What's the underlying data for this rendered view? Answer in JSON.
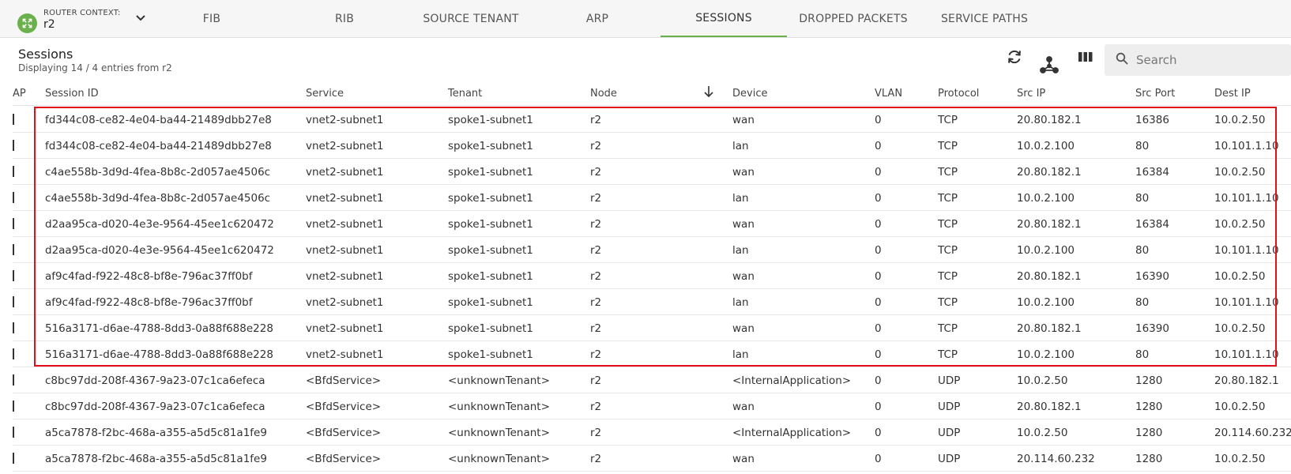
{
  "router": {
    "label": "ROUTER CONTEXT:",
    "value": "r2"
  },
  "tabs": [
    {
      "label": "FIB",
      "active": false
    },
    {
      "label": "RIB",
      "active": false
    },
    {
      "label": "SOURCE TENANT",
      "active": false
    },
    {
      "label": "ARP",
      "active": false
    },
    {
      "label": "SESSIONS",
      "active": true
    },
    {
      "label": "DROPPED PACKETS",
      "active": false
    },
    {
      "label": "SERVICE PATHS",
      "active": false
    }
  ],
  "page": {
    "title": "Sessions",
    "subtitle": "Displaying 14 / 4 entries from r2"
  },
  "search": {
    "placeholder": "Search",
    "value": ""
  },
  "colors": {
    "accent": "#6ab04c",
    "highlight": "#e3101c"
  },
  "icons": [
    "refresh-icon",
    "topology-icon",
    "columns-icon",
    "search-icon",
    "chevron-down-icon",
    "sort-down-icon"
  ],
  "table": {
    "partial_left_header": "AP",
    "columns": [
      "Session ID",
      "Service",
      "Tenant",
      "Node",
      "Device",
      "VLAN",
      "Protocol",
      "Src IP",
      "Src Port",
      "Dest IP"
    ],
    "sorted_column": "Node",
    "rows": [
      [
        "fd344c08-ce82-4e04-ba44-21489dbb27e8",
        "vnet2-subnet1",
        "spoke1-subnet1",
        "r2",
        "wan",
        "0",
        "TCP",
        "20.80.182.1",
        "16386",
        "10.0.2.50"
      ],
      [
        "fd344c08-ce82-4e04-ba44-21489dbb27e8",
        "vnet2-subnet1",
        "spoke1-subnet1",
        "r2",
        "lan",
        "0",
        "TCP",
        "10.0.2.100",
        "80",
        "10.101.1.10"
      ],
      [
        "c4ae558b-3d9d-4fea-8b8c-2d057ae4506c",
        "vnet2-subnet1",
        "spoke1-subnet1",
        "r2",
        "wan",
        "0",
        "TCP",
        "20.80.182.1",
        "16384",
        "10.0.2.50"
      ],
      [
        "c4ae558b-3d9d-4fea-8b8c-2d057ae4506c",
        "vnet2-subnet1",
        "spoke1-subnet1",
        "r2",
        "lan",
        "0",
        "TCP",
        "10.0.2.100",
        "80",
        "10.101.1.10"
      ],
      [
        "d2aa95ca-d020-4e3e-9564-45ee1c620472",
        "vnet2-subnet1",
        "spoke1-subnet1",
        "r2",
        "wan",
        "0",
        "TCP",
        "20.80.182.1",
        "16384",
        "10.0.2.50"
      ],
      [
        "d2aa95ca-d020-4e3e-9564-45ee1c620472",
        "vnet2-subnet1",
        "spoke1-subnet1",
        "r2",
        "lan",
        "0",
        "TCP",
        "10.0.2.100",
        "80",
        "10.101.1.10"
      ],
      [
        "af9c4fad-f922-48c8-bf8e-796ac37ff0bf",
        "vnet2-subnet1",
        "spoke1-subnet1",
        "r2",
        "wan",
        "0",
        "TCP",
        "20.80.182.1",
        "16390",
        "10.0.2.50"
      ],
      [
        "af9c4fad-f922-48c8-bf8e-796ac37ff0bf",
        "vnet2-subnet1",
        "spoke1-subnet1",
        "r2",
        "lan",
        "0",
        "TCP",
        "10.0.2.100",
        "80",
        "10.101.1.10"
      ],
      [
        "516a3171-d6ae-4788-8dd3-0a88f688e228",
        "vnet2-subnet1",
        "spoke1-subnet1",
        "r2",
        "wan",
        "0",
        "TCP",
        "20.80.182.1",
        "16390",
        "10.0.2.50"
      ],
      [
        "516a3171-d6ae-4788-8dd3-0a88f688e228",
        "vnet2-subnet1",
        "spoke1-subnet1",
        "r2",
        "lan",
        "0",
        "TCP",
        "10.0.2.100",
        "80",
        "10.101.1.10"
      ],
      [
        "c8bc97dd-208f-4367-9a23-07c1ca6efeca",
        "<BfdService>",
        "<unknownTenant>",
        "r2",
        "<InternalApplication>",
        "0",
        "UDP",
        "10.0.2.50",
        "1280",
        "20.80.182.1"
      ],
      [
        "c8bc97dd-208f-4367-9a23-07c1ca6efeca",
        "<BfdService>",
        "<unknownTenant>",
        "r2",
        "wan",
        "0",
        "UDP",
        "20.80.182.1",
        "1280",
        "10.0.2.50"
      ],
      [
        "a5ca7878-f2bc-468a-a355-a5d5c81a1fe9",
        "<BfdService>",
        "<unknownTenant>",
        "r2",
        "<InternalApplication>",
        "0",
        "UDP",
        "10.0.2.50",
        "1280",
        "20.114.60.232"
      ],
      [
        "a5ca7878-f2bc-468a-a355-a5d5c81a1fe9",
        "<BfdService>",
        "<unknownTenant>",
        "r2",
        "wan",
        "0",
        "UDP",
        "20.114.60.232",
        "1280",
        "10.0.2.50"
      ]
    ]
  }
}
